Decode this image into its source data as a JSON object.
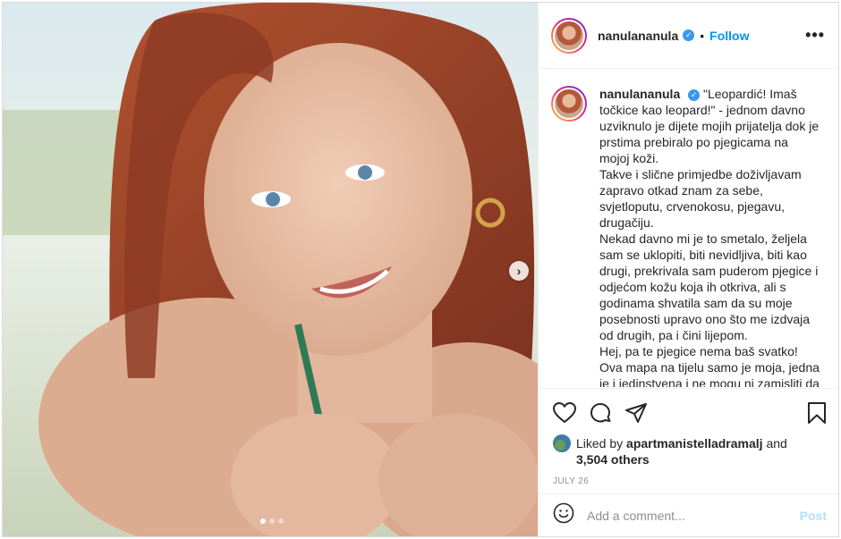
{
  "post": {
    "username": "nanulananula",
    "follow_label": "Follow",
    "separator": "•",
    "more_label": "•••",
    "caption_lines": [
      "\"Leopardić! Imaš",
      "točkice kao leopard!\" - jednom davno",
      "uzviknulo je dijete mojih prijatelja dok je",
      "prstima prebiralo po pjegicama na",
      "mojoj koži.",
      "Takve i slične primjedbe doživljavam",
      "zapravo otkad znam za sebe,",
      "svjetloputu, crvenokosu, pjegavu,",
      "drugačiju.",
      "Nekad davno mi je to smetalo, željela",
      "sam se uklopiti, biti nevidljiva, biti kao",
      "drugi, prekrivala sam puderom pjegice i",
      "odjećom kožu koja ih otkriva, ali s",
      "godinama shvatila sam da su moje",
      "posebnosti upravo ono što me izdvaja",
      "od drugih, pa i čini lijepom.",
      "Hej, pa te pjegice nema baš svatko!",
      "Ova mapa na tijelu samo je moja, jedna",
      "je i jedinstvena i ne mogu ni zamisliti da"
    ],
    "liked_prefix": "Liked by",
    "liked_by": "apartmanistelladramalj",
    "liked_and": "and",
    "likes_count": "3,504 others",
    "date": "JULY 26",
    "comment_placeholder": "Add a comment...",
    "post_label": "Post",
    "carousel_next": "›",
    "carousel_total": 3,
    "carousel_active": 1
  },
  "icons": {
    "verified": "verified-badge-icon",
    "like": "heart-icon",
    "comment": "comment-bubble-icon",
    "share": "paper-plane-icon",
    "save": "bookmark-icon",
    "emoji": "smiley-icon"
  },
  "colors": {
    "accent": "#0095f6",
    "verified": "#3897f0",
    "post_disabled": "#b2dffc",
    "muted": "#8e8e8e"
  }
}
